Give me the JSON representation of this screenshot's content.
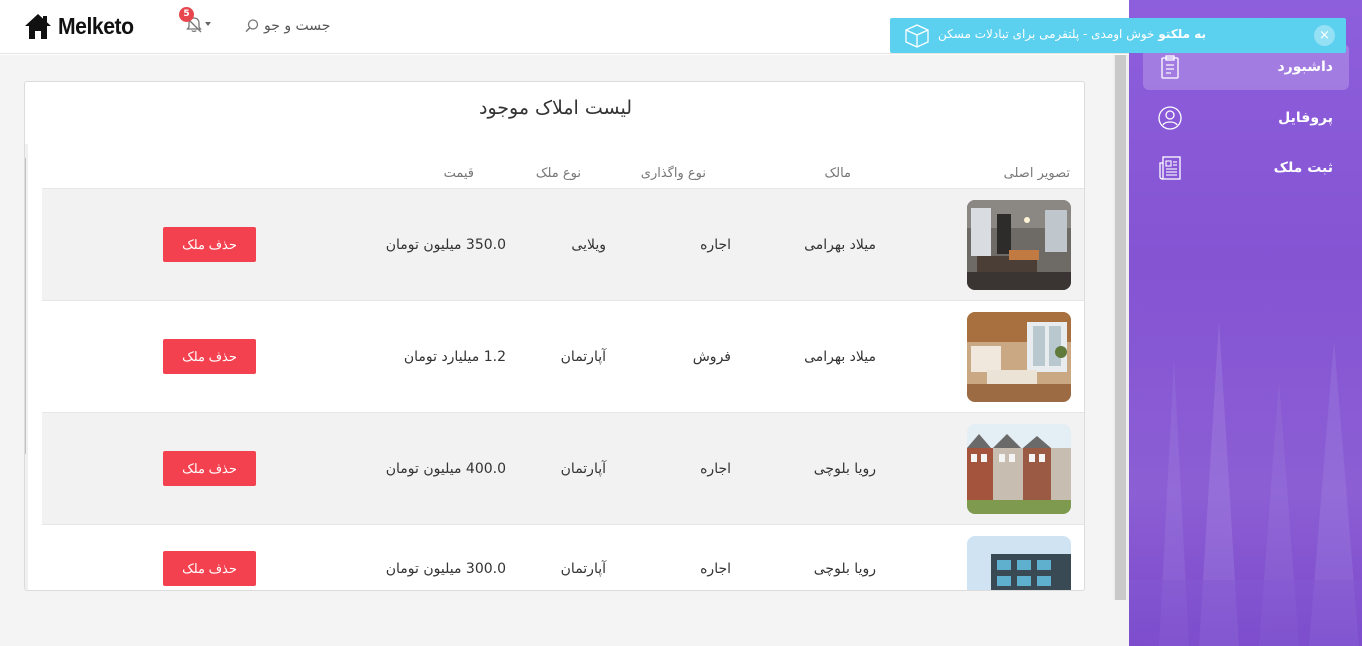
{
  "header": {
    "logo_text": "Melketo",
    "notification_count": "5",
    "search_placeholder": "جست و جو"
  },
  "toast": {
    "brand": "به ملکتو",
    "message": " خوش اومدی - پلتفرمی برای تبادلات مسکن",
    "close_label": "×"
  },
  "sidebar": {
    "items": [
      {
        "label": "داشبورد",
        "icon": "clipboard-icon",
        "active": true
      },
      {
        "label": "پروفایل",
        "icon": "user-circle-icon",
        "active": false
      },
      {
        "label": "ثبت ملک",
        "icon": "newspaper-icon",
        "active": false
      }
    ]
  },
  "main": {
    "title": "لیست املاک موجود",
    "columns": {
      "image": "تصویر اصلی",
      "owner": "مالک",
      "transfer_type": "نوع واگذاری",
      "property_type": "نوع ملک",
      "price": "قیمت"
    },
    "rows": [
      {
        "owner": "میلاد بهرامی",
        "transfer_type": "اجاره",
        "property_type": "ویلایی",
        "price": "350.0 میلیون تومان",
        "delete_label": "حذف ملک"
      },
      {
        "owner": "میلاد بهرامی",
        "transfer_type": "فروش",
        "property_type": "آپارتمان",
        "price": "1.2 میلیارد تومان",
        "delete_label": "حذف ملک"
      },
      {
        "owner": "رویا بلوچی",
        "transfer_type": "اجاره",
        "property_type": "آپارتمان",
        "price": "400.0 میلیون تومان",
        "delete_label": "حذف ملک"
      },
      {
        "owner": "رویا بلوچی",
        "transfer_type": "اجاره",
        "property_type": "آپارتمان",
        "price": "300.0 میلیون تومان",
        "delete_label": "حذف ملک"
      }
    ]
  },
  "colors": {
    "sidebar": "#8454d3",
    "toast": "#5bd0ef",
    "delete_button": "#f4414f",
    "badge": "#e8464f"
  }
}
